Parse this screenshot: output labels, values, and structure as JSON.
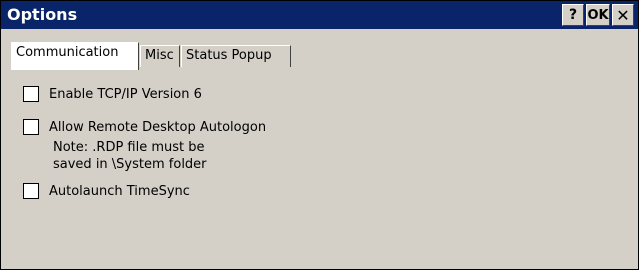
{
  "window": {
    "title": "Options",
    "buttons": {
      "help": "?",
      "ok": "OK",
      "close": "✕"
    }
  },
  "tabs": [
    {
      "label": "Communication",
      "active": true
    },
    {
      "label": "Misc",
      "active": false
    },
    {
      "label": "Status Popup",
      "active": false
    }
  ],
  "options": [
    {
      "label": "Enable TCP/IP Version 6",
      "checked": false
    },
    {
      "label": "Allow Remote Desktop Autologon",
      "checked": false,
      "note_lines": [
        "Note: .RDP file must be",
        "saved in \\System folder"
      ]
    },
    {
      "label": "Autolaunch TimeSync",
      "checked": false
    }
  ]
}
